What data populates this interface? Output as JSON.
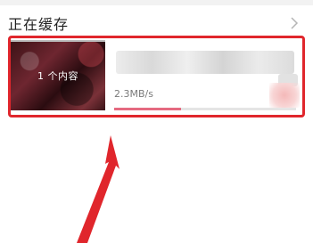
{
  "section": {
    "title": "正在缓存",
    "chevron_icon": "chevron-right-icon"
  },
  "download": {
    "thumbnail_label": "1 个内容",
    "speed": "2.3MB/s",
    "progress_fraction": 0.37
  },
  "annotation": {
    "highlight_color": "#e0262c",
    "arrow_color": "#e0262c"
  }
}
